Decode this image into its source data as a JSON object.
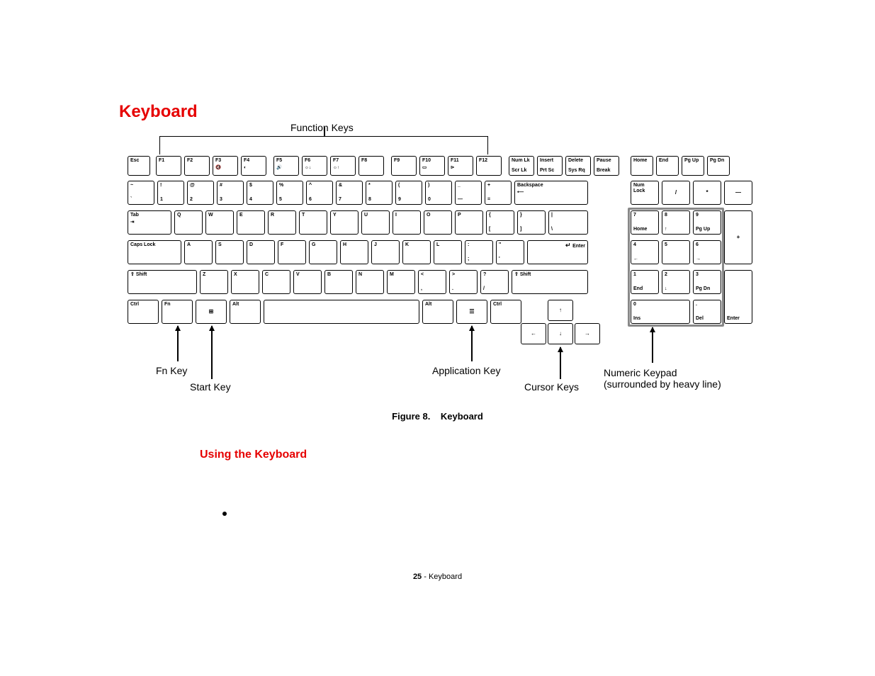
{
  "heading": "Keyboard",
  "labels": {
    "functionKeys": "Function Keys",
    "fnKey": "Fn Key",
    "startKey": "Start Key",
    "applicationKey": "Application Key",
    "cursorKeys": "Cursor Keys",
    "numericKeypad": "Numeric Keypad",
    "numericKeypadSub": "(surrounded by heavy line)"
  },
  "caption": {
    "prefix": "Figure 8.",
    "text": "Keyboard"
  },
  "subHeading": "Using the Keyboard",
  "footer": {
    "page": "25",
    "sep": " - ",
    "section": "Keyboard"
  },
  "keys": {
    "row0": {
      "esc": "Esc",
      "f": [
        "F1",
        "F2",
        "F3",
        "F4",
        "F5",
        "F6",
        "F7",
        "F8",
        "F9",
        "F10",
        "F11",
        "F12"
      ],
      "numlk": "Num Lk",
      "scrlk": "Scr Lk",
      "insert": "Insert",
      "prtsc": "Prt Sc",
      "delete": "Delete",
      "sysrq": "Sys Rq",
      "pause": "Pause",
      "break": "Break",
      "home": "Home",
      "end": "End",
      "pgup": "Pg Up",
      "pgdn": "Pg Dn"
    },
    "row1": {
      "tilde_top": "~",
      "tilde_bot": "`",
      "nums_top": [
        "!",
        "@",
        "#",
        "$",
        "%",
        "^",
        "&",
        "*",
        "(",
        ")",
        "_",
        "+"
      ],
      "nums_bot": [
        "1",
        "2",
        "3",
        "4",
        "5",
        "6",
        "7",
        "8",
        "9",
        "0",
        "—",
        "="
      ],
      "backspace": "Backspace",
      "num_numlock": "Num Lock",
      "num_div": "/",
      "num_mul": "*",
      "num_sub": "—"
    },
    "row2": {
      "tab": "Tab",
      "letters": [
        "Q",
        "W",
        "E",
        "R",
        "T",
        "Y",
        "U",
        "I",
        "O",
        "P"
      ],
      "lbracket_t": "{",
      "lbracket_b": "[",
      "rbracket_t": "}",
      "rbracket_b": "]",
      "bslash_t": "|",
      "bslash_b": "\\",
      "n7": "7",
      "n7s": "Home",
      "n8": "8",
      "n8s": "↑",
      "n9": "9",
      "n9s": "Pg Up",
      "plus": "+"
    },
    "row3": {
      "caps": "Caps Lock",
      "letters": [
        "A",
        "S",
        "D",
        "F",
        "G",
        "H",
        "J",
        "K",
        "L"
      ],
      "semi_t": ":",
      "semi_b": ";",
      "quote_t": "\"",
      "quote_b": "'",
      "enter": "Enter",
      "n4": "4",
      "n4s": "←",
      "n5": "5",
      "n5s": "",
      "n6": "6",
      "n6s": "→"
    },
    "row4": {
      "shift": "Shift",
      "letters": [
        "Z",
        "X",
        "C",
        "V",
        "B",
        "N",
        "M"
      ],
      "comma_t": "<",
      "comma_b": ",",
      "period_t": ">",
      "period_b": ".",
      "slash_t": "?",
      "slash_b": "/",
      "n1": "1",
      "n1s": "End",
      "n2": "2",
      "n2s": "↓",
      "n3": "3",
      "n3s": "Pg Dn",
      "numEnter": "Enter"
    },
    "row5": {
      "ctrl": "Ctrl",
      "fn": "Fn",
      "win": "⊞",
      "alt": "Alt",
      "space": "",
      "altR": "Alt",
      "menu": "☰",
      "ctrlR": "Ctrl",
      "up": "↑",
      "left": "←",
      "down": "↓",
      "right": "→",
      "n0": "0",
      "n0s": "Ins",
      "ndot": ".",
      "ndots": "Del"
    }
  }
}
